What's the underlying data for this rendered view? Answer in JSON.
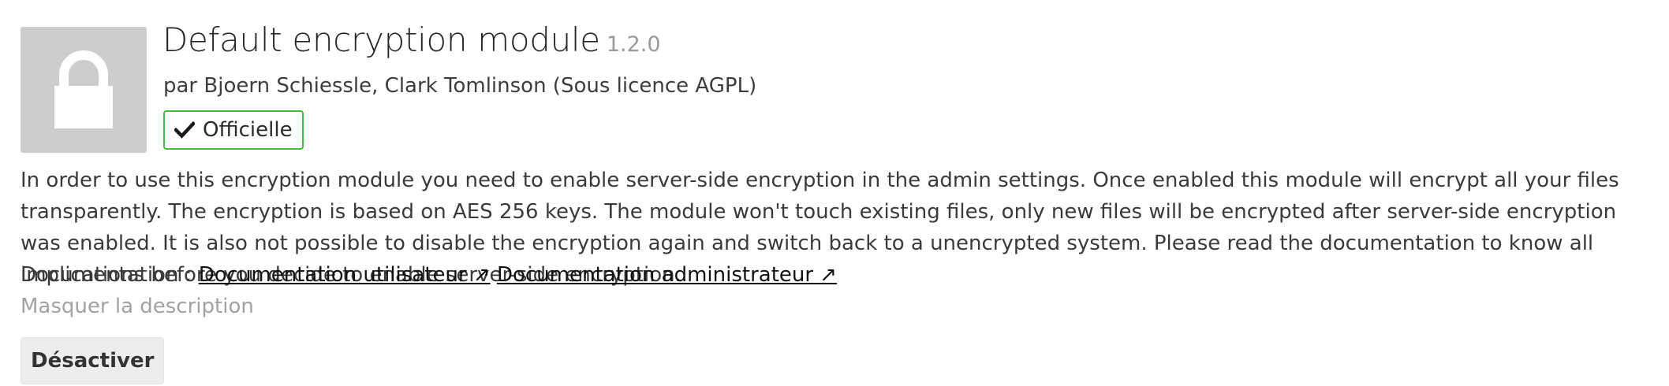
{
  "app": {
    "icon": "lock-icon",
    "title": "Default encryption module",
    "version": "1.2.0",
    "authors": "par Bjoern Schiessle, Clark Tomlinson (Sous licence AGPL)",
    "badge": {
      "icon": "check-icon",
      "label": "Officielle",
      "color": "#46ba3e"
    },
    "description": "In order to use this encryption module you need to enable server-side encryption in the admin settings. Once enabled this module will encrypt all your files transparently. The encryption is based on AES 256 keys. The module won't touch existing files, only new files will be encrypted after server-side encryption was enabled. It is also not possible to disable the encryption again and switch back to a unencrypted system. Please read the documentation to know all implications before you decide to enable server-side encryption.",
    "documentation": {
      "label": "Documentation :",
      "user_link": "Documentation utilisateur ↗",
      "admin_link": "Documentation administrateur ↗"
    },
    "hide_description": "Masquer la description",
    "disable_button": "Désactiver"
  },
  "colors": {
    "icon_background": "#cdcdcd",
    "muted_text": "#a2a2a2",
    "button_background": "#ededed"
  }
}
